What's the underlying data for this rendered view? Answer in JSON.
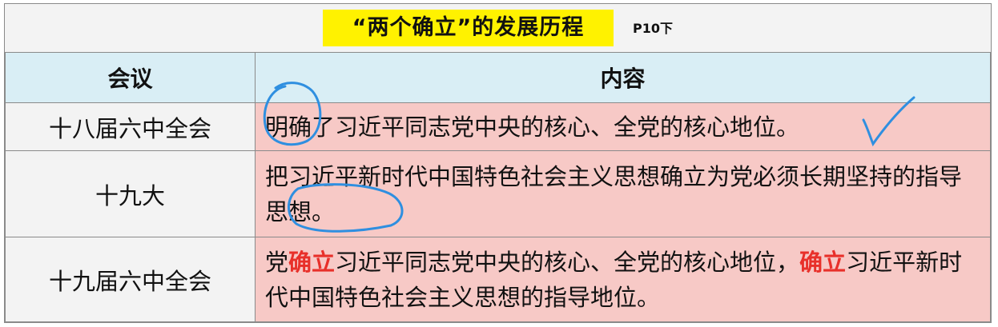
{
  "title": {
    "text": "“两个确立”的发展历程",
    "tag": "P10下"
  },
  "headers": {
    "meeting": "会议",
    "content": "内容"
  },
  "rows": [
    {
      "meeting": "十八届六中全会",
      "content": "明确了习近平同志党中央的核心、全党的核心地位。"
    },
    {
      "meeting": "十九大",
      "content": "把习近平新时代中国特色社会主义思想确立为党必须长期坚持的指导思想。"
    },
    {
      "meeting": "十九届六中全会",
      "parts": [
        "党",
        "确立",
        "习近平同志党中央的核心、全党的核心地位，",
        "确立",
        "习近平新时代中国特色社会主义思想的指导地位。"
      ]
    }
  ],
  "colors": {
    "title_highlight": "#fff200",
    "header_bg": "#d9eef5",
    "content_bg": "#f7c9c6",
    "emphasis": "#e8302a",
    "ink": "#2f8fe0"
  }
}
